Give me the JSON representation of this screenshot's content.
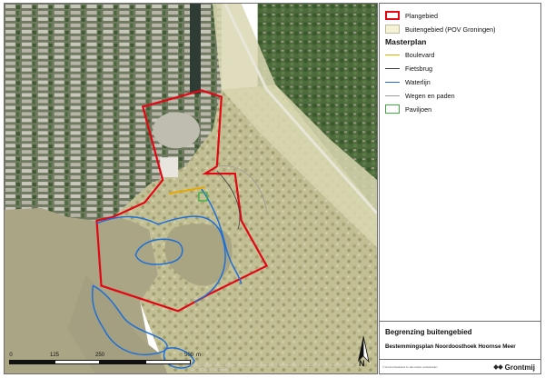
{
  "map": {
    "legend": {
      "items_top": [
        {
          "label": "Plangebied",
          "key": "rect-red",
          "color": "#e30613"
        },
        {
          "label": "Buitengebied (POV Groningen)",
          "key": "rect-pale",
          "color": "#f4f3d6"
        }
      ],
      "heading": "Masterplan",
      "items_masterplan": [
        {
          "label": "Boulevard",
          "key": "line-orange",
          "color": "#e8a800"
        },
        {
          "label": "Fietsbrug",
          "key": "line-dark",
          "color": "#3a3a3a"
        },
        {
          "label": "Waterlijn",
          "key": "line-blue",
          "color": "#1f6fd6"
        },
        {
          "label": "Wegen en paden",
          "key": "line-grey",
          "color": "#9a9a9a"
        },
        {
          "label": "Paviljoen",
          "key": "rect-green",
          "color": "#3cae3c"
        }
      ]
    },
    "title": "Begrenzing buitengebied",
    "subtitle": "Bestemmingsplan Noordoosthoek Hoornse Meer",
    "footer_copyright": "© Grontmij Nederland bv. alle rechten voorbehouden",
    "logo_text": "Grontmij",
    "scale": {
      "ticks": [
        "0",
        "125",
        "250",
        "500"
      ],
      "unit": "m"
    },
    "map_credit": "Bron: DigitalGlobe, GeoEye, Earthstar Geographics, CNES/Airbus DS, USDA, USGS, AeroGRID, IGN, en de GIS User Community",
    "north_label": "N",
    "colors": {
      "water": "#aaa585",
      "plan_boundary": "#e30613",
      "waterline": "#1f6fd6",
      "boulevard": "#e8a800",
      "pavilion": "#3cae3c"
    }
  }
}
